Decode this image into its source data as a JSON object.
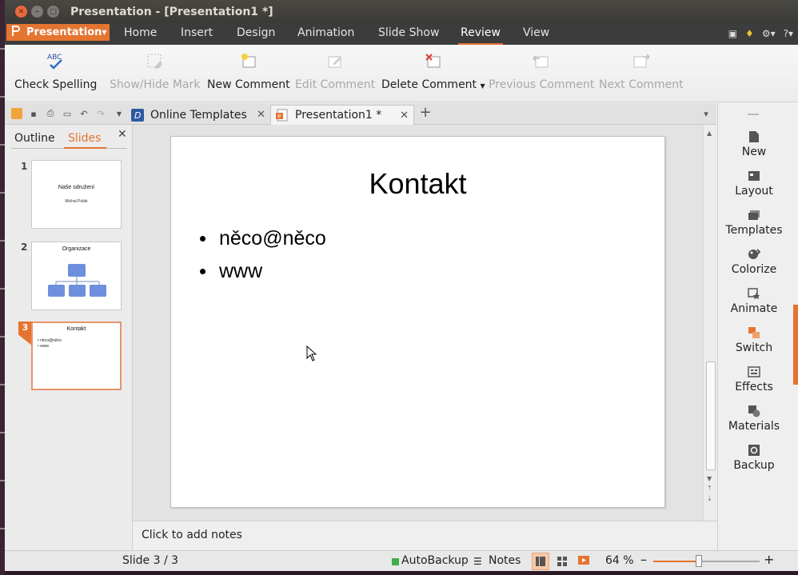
{
  "window": {
    "title": "Presentation - [Presentation1 *]"
  },
  "app_menu": {
    "label": "Presentation"
  },
  "menu": [
    "Home",
    "Insert",
    "Design",
    "Animation",
    "Slide Show",
    "Review",
    "View"
  ],
  "menu_active": "Review",
  "menu_right_help": "?",
  "ribbon": {
    "check_spelling": "Check Spelling",
    "check_spelling_icon_text": "ABC",
    "show_hide_mark": "Show/Hide Mark",
    "new_comment": "New Comment",
    "edit_comment": "Edit Comment",
    "delete_comment": "Delete Comment",
    "previous_comment": "Previous Comment",
    "next_comment": "Next Comment"
  },
  "doc_tabs": [
    {
      "label": "Online Templates",
      "icon": "wps-online-icon"
    },
    {
      "label": "Presentation1 *",
      "icon": "presentation-file-icon"
    }
  ],
  "left_panel": {
    "outline_tab": "Outline",
    "slides_tab": "Slides",
    "thumbnails": [
      {
        "num": "1",
        "title": "Naše sdružení",
        "subtitle": "Michal Polák"
      },
      {
        "num": "2",
        "title": "Organizace"
      },
      {
        "num": "3",
        "title": "Kontakt",
        "bullets": [
          "něco@něco",
          "www"
        ]
      }
    ]
  },
  "slide": {
    "title": "Kontakt",
    "bullets": [
      "něco@něco",
      "www"
    ]
  },
  "notes": {
    "placeholder": "Click to add notes"
  },
  "right_sidebar": [
    "New",
    "Layout",
    "Templates",
    "Colorize",
    "Animate",
    "Switch",
    "Effects",
    "Materials",
    "Backup"
  ],
  "status": {
    "slide_info": "Slide 3 / 3",
    "autobackup": "AutoBackup",
    "notes": "Notes",
    "zoom": "64 %",
    "zoom_value": 64
  },
  "colors": {
    "accent": "#e57431",
    "menubar": "#3c3c3c",
    "titlebar": "#3b3a36"
  }
}
